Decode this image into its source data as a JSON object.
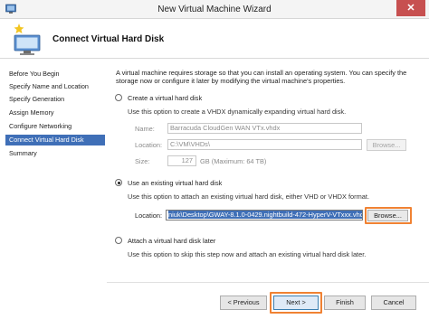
{
  "window": {
    "title": "New Virtual Machine Wizard",
    "close_glyph": "✕"
  },
  "header": {
    "title": "Connect Virtual Hard Disk",
    "icon": "virtual-machine-wizard-icon"
  },
  "nav": {
    "items": [
      {
        "label": "Before You Begin",
        "active": false
      },
      {
        "label": "Specify Name and Location",
        "active": false
      },
      {
        "label": "Specify Generation",
        "active": false
      },
      {
        "label": "Assign Memory",
        "active": false
      },
      {
        "label": "Configure Networking",
        "active": false
      },
      {
        "label": "Connect Virtual Hard Disk",
        "active": true
      },
      {
        "label": "Summary",
        "active": false
      }
    ]
  },
  "intro": "A virtual machine requires storage so that you can install an operating system. You can specify the storage now or configure it later by modifying the virtual machine's properties.",
  "options": {
    "create": {
      "label": "Create a virtual hard disk",
      "selected": false,
      "description": "Use this option to create a VHDX dynamically expanding virtual hard disk.",
      "name_label": "Name:",
      "name_value": "Barracuda CloudGen WAN VTx.vhdx",
      "location_label": "Location:",
      "location_value": "C:\\VM\\VHDs\\",
      "browse_label": "Browse...",
      "size_label": "Size:",
      "size_value": "127",
      "size_unit": "GB (Maximum: 64 TB)"
    },
    "existing": {
      "label": "Use an existing virtual hard disk",
      "selected": true,
      "description": "Use this option to attach an existing virtual hard disk, either VHD or VHDX format.",
      "location_label": "Location:",
      "location_value": "niuk\\Desktop\\GWAY-8.1.0-0429.nightbuild-472-HyperV-VTxxx.vhdx",
      "browse_label": "Browse..."
    },
    "later": {
      "label": "Attach a virtual hard disk later",
      "selected": false,
      "description": "Use this option to skip this step now and attach an existing virtual hard disk later."
    }
  },
  "buttons": {
    "previous": "< Previous",
    "next": "Next >",
    "finish": "Finish",
    "cancel": "Cancel"
  },
  "colors": {
    "accent": "#3f6fb7",
    "highlight": "#f08233",
    "close": "#c75050"
  }
}
